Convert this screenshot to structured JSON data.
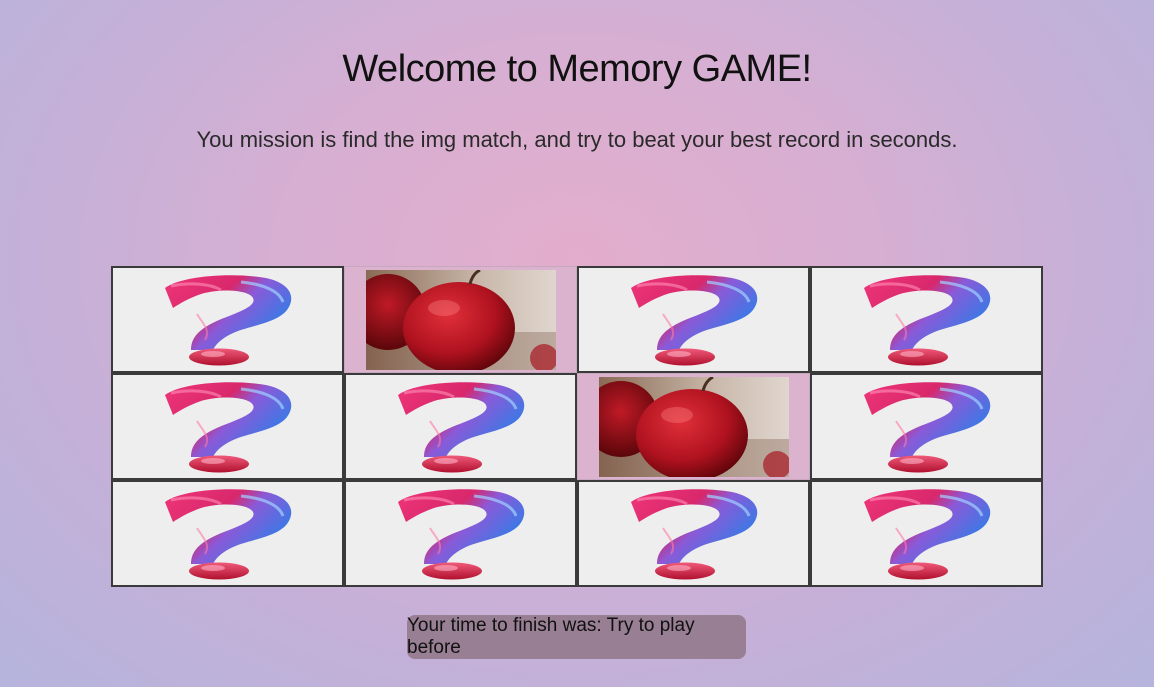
{
  "header": {
    "title": "Welcome to Memory GAME!",
    "subtitle": "You mission is find the img match, and try to beat your best record in seconds."
  },
  "board": {
    "rows": 3,
    "columns": 4,
    "cards": [
      {
        "state": "hidden",
        "icon": "question-mark-icon"
      },
      {
        "state": "revealed",
        "icon": "apple-image"
      },
      {
        "state": "hidden",
        "icon": "question-mark-icon"
      },
      {
        "state": "hidden",
        "icon": "question-mark-icon"
      },
      {
        "state": "hidden",
        "icon": "question-mark-icon"
      },
      {
        "state": "hidden",
        "icon": "question-mark-icon"
      },
      {
        "state": "revealed",
        "icon": "apple-image"
      },
      {
        "state": "hidden",
        "icon": "question-mark-icon"
      },
      {
        "state": "hidden",
        "icon": "question-mark-icon"
      },
      {
        "state": "hidden",
        "icon": "question-mark-icon"
      },
      {
        "state": "hidden",
        "icon": "question-mark-icon"
      },
      {
        "state": "hidden",
        "icon": "question-mark-icon"
      }
    ]
  },
  "status": {
    "text": "Your time to finish was: Try to play before"
  },
  "colors": {
    "card_back": "#eeeeee",
    "card_border": "#3a3a3a",
    "status_bg": "#987f93",
    "question_pink": "#e8306a",
    "question_blue": "#2f7fe0",
    "apple_red": "#b81522"
  }
}
